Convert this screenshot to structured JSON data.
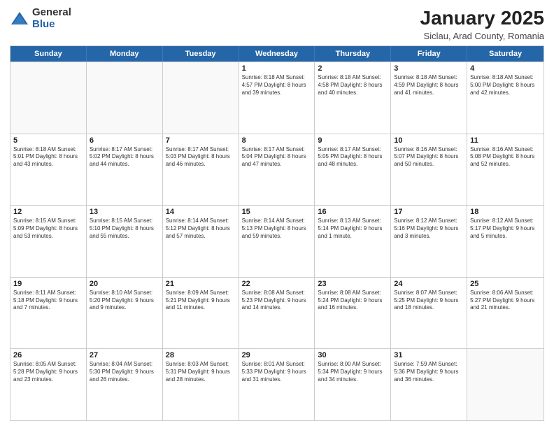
{
  "logo": {
    "general": "General",
    "blue": "Blue"
  },
  "title": "January 2025",
  "location": "Siclau, Arad County, Romania",
  "header_days": [
    "Sunday",
    "Monday",
    "Tuesday",
    "Wednesday",
    "Thursday",
    "Friday",
    "Saturday"
  ],
  "weeks": [
    [
      {
        "day": "",
        "info": ""
      },
      {
        "day": "",
        "info": ""
      },
      {
        "day": "",
        "info": ""
      },
      {
        "day": "1",
        "info": "Sunrise: 8:18 AM\nSunset: 4:57 PM\nDaylight: 8 hours\nand 39 minutes."
      },
      {
        "day": "2",
        "info": "Sunrise: 8:18 AM\nSunset: 4:58 PM\nDaylight: 8 hours\nand 40 minutes."
      },
      {
        "day": "3",
        "info": "Sunrise: 8:18 AM\nSunset: 4:59 PM\nDaylight: 8 hours\nand 41 minutes."
      },
      {
        "day": "4",
        "info": "Sunrise: 8:18 AM\nSunset: 5:00 PM\nDaylight: 8 hours\nand 42 minutes."
      }
    ],
    [
      {
        "day": "5",
        "info": "Sunrise: 8:18 AM\nSunset: 5:01 PM\nDaylight: 8 hours\nand 43 minutes."
      },
      {
        "day": "6",
        "info": "Sunrise: 8:17 AM\nSunset: 5:02 PM\nDaylight: 8 hours\nand 44 minutes."
      },
      {
        "day": "7",
        "info": "Sunrise: 8:17 AM\nSunset: 5:03 PM\nDaylight: 8 hours\nand 46 minutes."
      },
      {
        "day": "8",
        "info": "Sunrise: 8:17 AM\nSunset: 5:04 PM\nDaylight: 8 hours\nand 47 minutes."
      },
      {
        "day": "9",
        "info": "Sunrise: 8:17 AM\nSunset: 5:05 PM\nDaylight: 8 hours\nand 48 minutes."
      },
      {
        "day": "10",
        "info": "Sunrise: 8:16 AM\nSunset: 5:07 PM\nDaylight: 8 hours\nand 50 minutes."
      },
      {
        "day": "11",
        "info": "Sunrise: 8:16 AM\nSunset: 5:08 PM\nDaylight: 8 hours\nand 52 minutes."
      }
    ],
    [
      {
        "day": "12",
        "info": "Sunrise: 8:15 AM\nSunset: 5:09 PM\nDaylight: 8 hours\nand 53 minutes."
      },
      {
        "day": "13",
        "info": "Sunrise: 8:15 AM\nSunset: 5:10 PM\nDaylight: 8 hours\nand 55 minutes."
      },
      {
        "day": "14",
        "info": "Sunrise: 8:14 AM\nSunset: 5:12 PM\nDaylight: 8 hours\nand 57 minutes."
      },
      {
        "day": "15",
        "info": "Sunrise: 8:14 AM\nSunset: 5:13 PM\nDaylight: 8 hours\nand 59 minutes."
      },
      {
        "day": "16",
        "info": "Sunrise: 8:13 AM\nSunset: 5:14 PM\nDaylight: 9 hours\nand 1 minute."
      },
      {
        "day": "17",
        "info": "Sunrise: 8:12 AM\nSunset: 5:16 PM\nDaylight: 9 hours\nand 3 minutes."
      },
      {
        "day": "18",
        "info": "Sunrise: 8:12 AM\nSunset: 5:17 PM\nDaylight: 9 hours\nand 5 minutes."
      }
    ],
    [
      {
        "day": "19",
        "info": "Sunrise: 8:11 AM\nSunset: 5:18 PM\nDaylight: 9 hours\nand 7 minutes."
      },
      {
        "day": "20",
        "info": "Sunrise: 8:10 AM\nSunset: 5:20 PM\nDaylight: 9 hours\nand 9 minutes."
      },
      {
        "day": "21",
        "info": "Sunrise: 8:09 AM\nSunset: 5:21 PM\nDaylight: 9 hours\nand 11 minutes."
      },
      {
        "day": "22",
        "info": "Sunrise: 8:08 AM\nSunset: 5:23 PM\nDaylight: 9 hours\nand 14 minutes."
      },
      {
        "day": "23",
        "info": "Sunrise: 8:08 AM\nSunset: 5:24 PM\nDaylight: 9 hours\nand 16 minutes."
      },
      {
        "day": "24",
        "info": "Sunrise: 8:07 AM\nSunset: 5:25 PM\nDaylight: 9 hours\nand 18 minutes."
      },
      {
        "day": "25",
        "info": "Sunrise: 8:06 AM\nSunset: 5:27 PM\nDaylight: 9 hours\nand 21 minutes."
      }
    ],
    [
      {
        "day": "26",
        "info": "Sunrise: 8:05 AM\nSunset: 5:28 PM\nDaylight: 9 hours\nand 23 minutes."
      },
      {
        "day": "27",
        "info": "Sunrise: 8:04 AM\nSunset: 5:30 PM\nDaylight: 9 hours\nand 26 minutes."
      },
      {
        "day": "28",
        "info": "Sunrise: 8:03 AM\nSunset: 5:31 PM\nDaylight: 9 hours\nand 28 minutes."
      },
      {
        "day": "29",
        "info": "Sunrise: 8:01 AM\nSunset: 5:33 PM\nDaylight: 9 hours\nand 31 minutes."
      },
      {
        "day": "30",
        "info": "Sunrise: 8:00 AM\nSunset: 5:34 PM\nDaylight: 9 hours\nand 34 minutes."
      },
      {
        "day": "31",
        "info": "Sunrise: 7:59 AM\nSunset: 5:36 PM\nDaylight: 9 hours\nand 36 minutes."
      },
      {
        "day": "",
        "info": ""
      }
    ]
  ]
}
